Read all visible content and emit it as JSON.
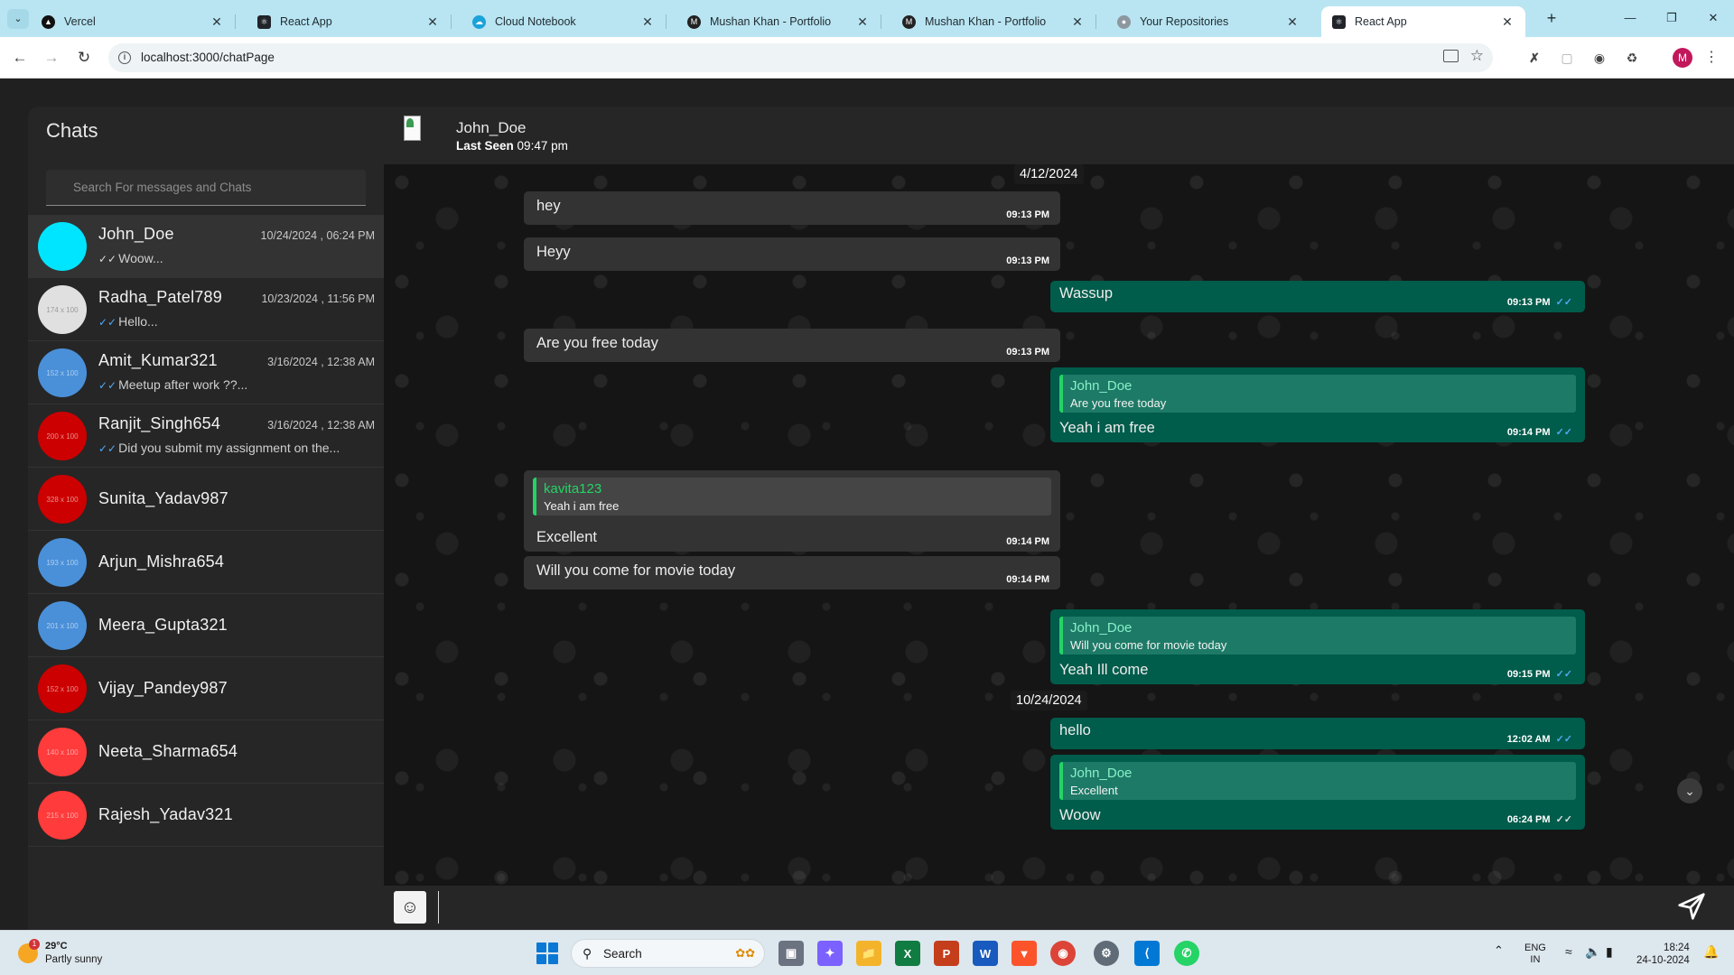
{
  "browser": {
    "tabs": [
      {
        "title": "Vercel",
        "favicon_color": "#111111"
      },
      {
        "title": "React App",
        "favicon_color": "#20232a"
      },
      {
        "title": "Cloud Notebook",
        "favicon_color": "#1aa3d9"
      },
      {
        "title": "Mushan Khan - Portfolio",
        "favicon_color": "#222222"
      },
      {
        "title": "Mushan Khan - Portfolio",
        "favicon_color": "#222222"
      },
      {
        "title": "Your Repositories",
        "favicon_color": "#8d97a0"
      },
      {
        "title": "React App",
        "favicon_color": "#20232a",
        "active": true
      }
    ],
    "url": "localhost:3000/chatPage",
    "profile_initial": "M"
  },
  "sidebar": {
    "title": "Chats",
    "search_placeholder": "Search For messages and Chats",
    "chats": [
      {
        "name": "John_Doe",
        "time": "10/24/2024 , 06:24 PM",
        "preview": "Woow...",
        "tick": "grey",
        "avatar_color": "#00e5ff",
        "avatar_text": "",
        "active": true
      },
      {
        "name": "Radha_Patel789",
        "time": "10/23/2024 , 11:56 PM",
        "preview": "Hello...",
        "tick": "blue",
        "avatar_color": "#e0e0e0",
        "avatar_text": "174 x 100"
      },
      {
        "name": "Amit_Kumar321",
        "time": "3/16/2024 , 12:38 AM",
        "preview": "Meetup after work ??...",
        "tick": "blue",
        "avatar_color": "#4a90d9",
        "avatar_text": "152 x 100"
      },
      {
        "name": "Ranjit_Singh654",
        "time": "3/16/2024 , 12:38 AM",
        "preview": "Did you submit my assignment on the...",
        "tick": "blue",
        "avatar_color": "#cc0000",
        "avatar_text": "200 x 100"
      },
      {
        "name": "Sunita_Yadav987",
        "time": "",
        "preview": "",
        "avatar_color": "#cc0000",
        "avatar_text": "328 x 100"
      },
      {
        "name": "Arjun_Mishra654",
        "time": "",
        "preview": "",
        "avatar_color": "#4a90d9",
        "avatar_text": "193 x 100"
      },
      {
        "name": "Meera_Gupta321",
        "time": "",
        "preview": "",
        "avatar_color": "#4a90d9",
        "avatar_text": "201 x 100"
      },
      {
        "name": "Vijay_Pandey987",
        "time": "",
        "preview": "",
        "avatar_color": "#cc0000",
        "avatar_text": "152 x 100"
      },
      {
        "name": "Neeta_Sharma654",
        "time": "",
        "preview": "",
        "avatar_color": "#ff3b3b",
        "avatar_text": "140 x 100"
      },
      {
        "name": "Rajesh_Yadav321",
        "time": "",
        "preview": "",
        "avatar_color": "#ff3b3b",
        "avatar_text": "215 x 100"
      }
    ]
  },
  "chat": {
    "contact_name": "John_Doe",
    "last_seen_label": "Last Seen",
    "last_seen_time": "09:47 pm",
    "dates": [
      "4/12/2024",
      "10/24/2024"
    ],
    "messages": [
      {
        "dir": "in",
        "text": "hey",
        "time": "09:13 PM"
      },
      {
        "dir": "in",
        "text": "Heyy",
        "time": "09:13 PM"
      },
      {
        "dir": "out",
        "text": "Wassup",
        "time": "09:13 PM"
      },
      {
        "dir": "in",
        "text": "Are you free today",
        "time": "09:13 PM"
      },
      {
        "dir": "out",
        "text": "Yeah i am free",
        "time": "09:14 PM",
        "quote_name": "John_Doe",
        "quote_text": "Are you free today"
      },
      {
        "dir": "in",
        "text": "Excellent",
        "time": "09:14 PM",
        "quote_name": "kavita123",
        "quote_text": "Yeah i am free"
      },
      {
        "dir": "in",
        "text": "Will you come for movie today",
        "time": "09:14 PM"
      },
      {
        "dir": "out",
        "text": "Yeah Ill come",
        "time": "09:15 PM",
        "quote_name": "John_Doe",
        "quote_text": "Will you come for movie today"
      },
      {
        "dir": "out",
        "text": "hello",
        "time": "12:02 AM"
      },
      {
        "dir": "out",
        "text": "Woow",
        "time": "06:24 PM",
        "quote_name": "John_Doe",
        "quote_text": "Excellent"
      }
    ],
    "input_value": ""
  },
  "taskbar": {
    "temperature": "29°C",
    "weather": "Partly sunny",
    "weather_badge": "1",
    "search_label": "Search",
    "lang_1": "ENG",
    "lang_2": "IN",
    "clock_time": "18:24",
    "clock_date": "24-10-2024"
  },
  "colors": {
    "outgoing_bubble": "#005c4b",
    "incoming_bubble": "#333333",
    "read_tick": "#4ea9f5",
    "quote_accent": "#25d366"
  }
}
